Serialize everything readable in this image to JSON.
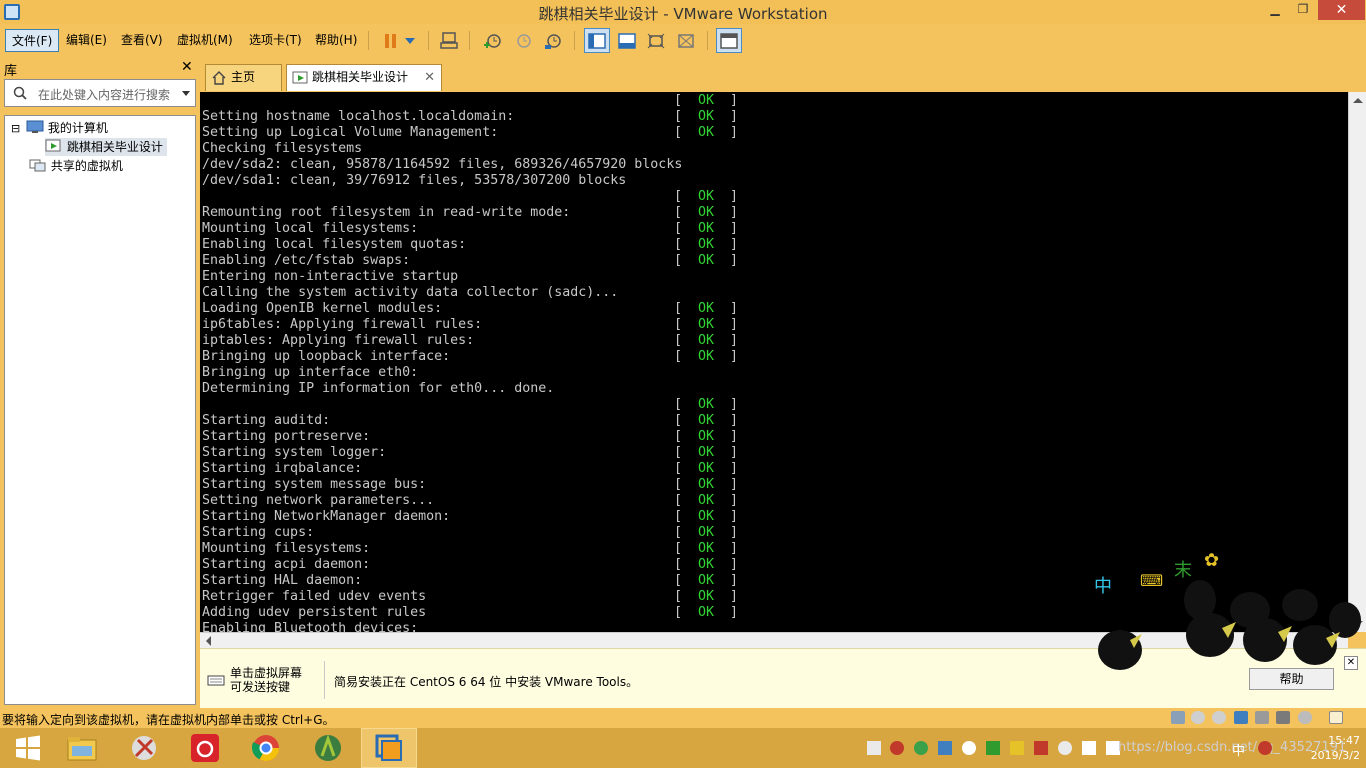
{
  "window": {
    "title": "跳棋相关毕业设计 - VMware Workstation",
    "minimize": "▁",
    "maximize": "❐",
    "close": "✕"
  },
  "menu": [
    "文件(F)",
    "编辑(E)",
    "查看(V)",
    "虚拟机(M)",
    "选项卡(T)",
    "帮助(H)"
  ],
  "library": {
    "header": "库",
    "close": "✕",
    "search_placeholder": "在此处键入内容进行搜索",
    "tree": {
      "my_computer": "我的计算机",
      "vm": "跳棋相关毕业设计",
      "shared": "共享的虚拟机",
      "expand": "⊟"
    }
  },
  "tabs": [
    {
      "label": "主页",
      "icon": "home-icon"
    },
    {
      "label": "跳棋相关毕业设计",
      "icon": "vm-icon"
    }
  ],
  "tab_close": "✕",
  "console": {
    "ok_text": "OK",
    "lines": [
      {
        "text": "",
        "ok": true
      },
      {
        "text": "Setting hostname localhost.localdomain:",
        "ok": true
      },
      {
        "text": "Setting up Logical Volume Management:",
        "ok": true
      },
      {
        "text": "Checking filesystems",
        "ok": false
      },
      {
        "text": "/dev/sda2: clean, 95878/1164592 files, 689326/4657920 blocks",
        "ok": false
      },
      {
        "text": "/dev/sda1: clean, 39/76912 files, 53578/307200 blocks",
        "ok": false
      },
      {
        "text": "",
        "ok": true
      },
      {
        "text": "Remounting root filesystem in read-write mode:",
        "ok": true
      },
      {
        "text": "Mounting local filesystems:",
        "ok": true
      },
      {
        "text": "Enabling local filesystem quotas:",
        "ok": true
      },
      {
        "text": "Enabling /etc/fstab swaps:",
        "ok": true
      },
      {
        "text": "Entering non-interactive startup",
        "ok": false
      },
      {
        "text": "Calling the system activity data collector (sadc)...",
        "ok": false
      },
      {
        "text": "Loading OpenIB kernel modules:",
        "ok": true
      },
      {
        "text": "ip6tables: Applying firewall rules:",
        "ok": true
      },
      {
        "text": "iptables: Applying firewall rules:",
        "ok": true
      },
      {
        "text": "Bringing up loopback interface:",
        "ok": true
      },
      {
        "text": "Bringing up interface eth0:",
        "ok": false
      },
      {
        "text": "Determining IP information for eth0... done.",
        "ok": false
      },
      {
        "text": "",
        "ok": true
      },
      {
        "text": "Starting auditd:",
        "ok": true
      },
      {
        "text": "Starting portreserve:",
        "ok": true
      },
      {
        "text": "Starting system logger:",
        "ok": true
      },
      {
        "text": "Starting irqbalance:",
        "ok": true
      },
      {
        "text": "Starting system message bus:",
        "ok": true
      },
      {
        "text": "Setting network parameters...",
        "ok": true
      },
      {
        "text": "Starting NetworkManager daemon:",
        "ok": true
      },
      {
        "text": "Starting cups:",
        "ok": true
      },
      {
        "text": "Mounting filesystems:",
        "ok": true
      },
      {
        "text": "Starting acpi daemon:",
        "ok": true
      },
      {
        "text": "Starting HAL daemon:",
        "ok": true
      },
      {
        "text": "Retrigger failed udev events",
        "ok": true
      },
      {
        "text": "Adding udev persistent rules",
        "ok": true
      },
      {
        "text": "Enabling Bluetooth devices:",
        "ok": false
      }
    ]
  },
  "info_bar": {
    "line1": "单击虚拟屏幕",
    "line2": "可发送按键",
    "message": "简易安装正在 CentOS 6 64 位 中安装 VMware Tools。",
    "help_button": "帮助",
    "close": "✕"
  },
  "status_bar": {
    "text": "要将输入定向到该虚拟机，请在虚拟机内部单击或按 Ctrl+G。"
  },
  "taskbar": {
    "time": "15:47",
    "date": "2019/3/2",
    "watermark": "https://blog.csdn.net/qq_43527191",
    "ime": "中"
  },
  "sticker": {
    "chars": "中 ⌨ 末 ✿"
  },
  "colors": {
    "theme": "#f4c35d",
    "ok_green": "#33d633",
    "console_bg": "#000000"
  }
}
